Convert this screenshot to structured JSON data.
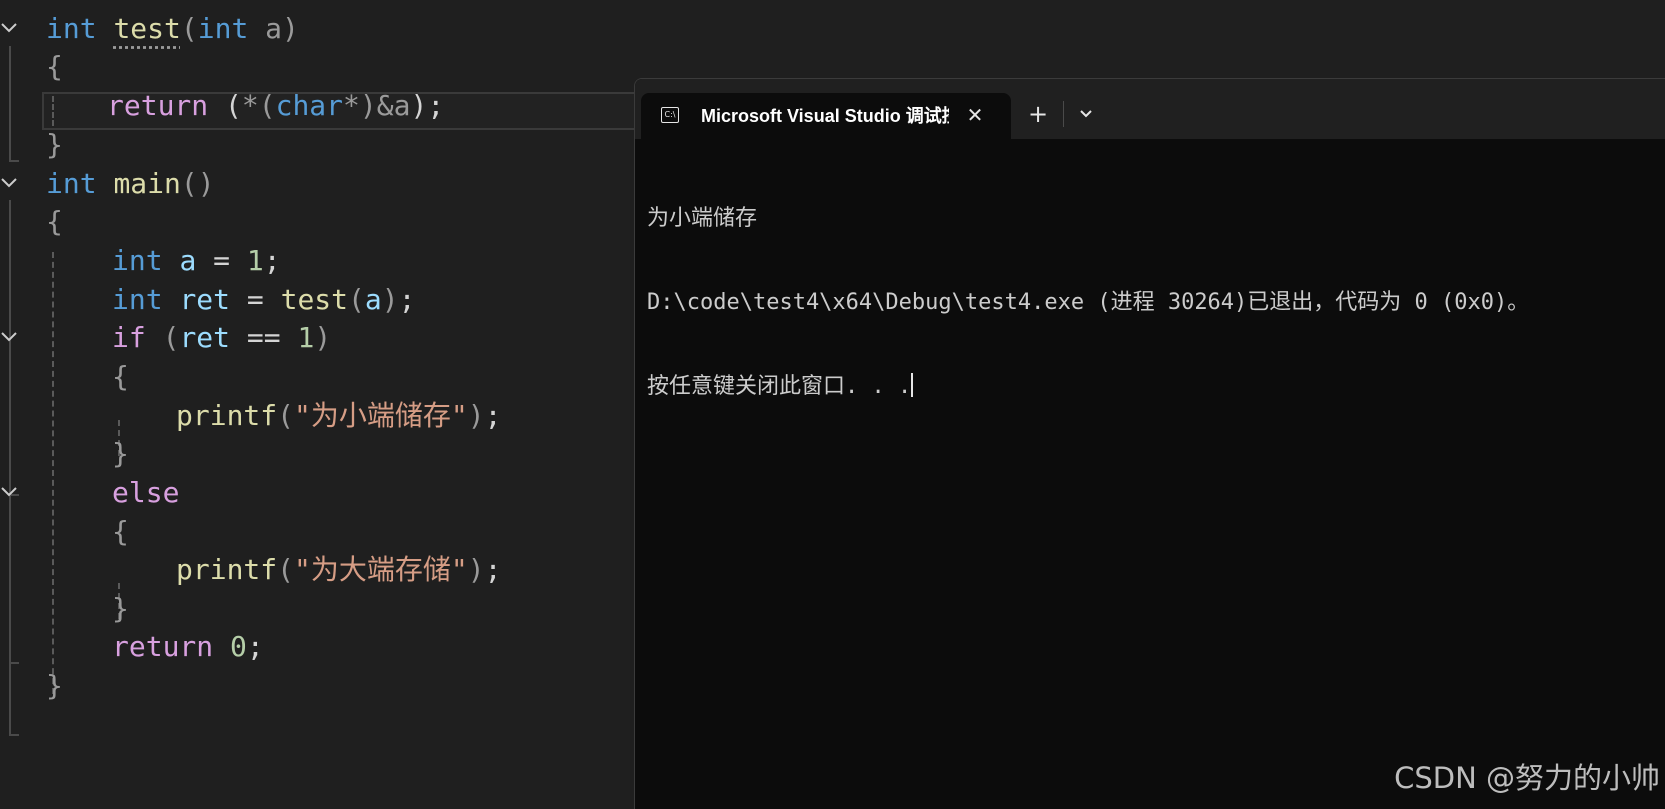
{
  "editor": {
    "lines": {
      "l1": {
        "type": "int",
        "fn": "test",
        "p1": "(",
        "ptype": "int",
        "param": " a",
        "p2": ")"
      },
      "l2": {
        "brace": "{"
      },
      "l3": {
        "ret": "return",
        "a": " (",
        "b": "*(",
        "c": "char",
        "d": "*)",
        "e": "&a",
        "f": ")",
        "g": ";"
      },
      "l4": {
        "brace": "}"
      },
      "l5": {
        "type": "int",
        "fn": "main",
        "paren": "()"
      },
      "l6": {
        "brace": "{"
      },
      "l7": {
        "type": "int",
        "var": "a",
        "op": " = ",
        "num": "1",
        "semi": ";"
      },
      "l8": {
        "type": "int",
        "var": "ret",
        "op": " = ",
        "fn": "test",
        "p1": "(",
        "arg": "a",
        "p2": ")",
        "semi": ";"
      },
      "l9": {
        "kw": "if",
        "p1": " (",
        "var": "ret",
        "op": " == ",
        "num": "1",
        "p2": ")"
      },
      "l10": {
        "brace": "{"
      },
      "l11": {
        "fn": "printf",
        "p1": "(",
        "str": "\"为小端储存\"",
        "p2": ")",
        "semi": ";"
      },
      "l12": {
        "brace": "}"
      },
      "l13": {
        "kw": "else"
      },
      "l14": {
        "brace": "{"
      },
      "l15": {
        "fn": "printf",
        "p1": "(",
        "str": "\"为大端存储\"",
        "p2": ")",
        "semi": ";"
      },
      "l16": {
        "brace": "}"
      },
      "l17": {
        "kw": "return",
        "num": "0",
        "semi": ";"
      },
      "l18": {
        "brace": "}"
      }
    }
  },
  "terminal": {
    "tab_title": "Microsoft Visual Studio 调试控制台",
    "tab_icon": "console-icon",
    "close_glyph": "✕",
    "new_tab_glyph": "+",
    "output": [
      "为小端储存",
      "D:\\code\\test4\\x64\\Debug\\test4.exe (进程 30264)已退出，代码为 0 (0x0)。",
      "按任意键关闭此窗口. . ."
    ]
  },
  "watermark": "CSDN @努力的小帅",
  "colors": {
    "keyword": "#569cd6",
    "control": "#d8a0df",
    "function": "#dcdcaa",
    "variable": "#9cdcfe",
    "number": "#b5cea8",
    "string": "#d69d85",
    "editor_bg": "#1f1f1f",
    "terminal_bg": "#0c0c0c"
  }
}
